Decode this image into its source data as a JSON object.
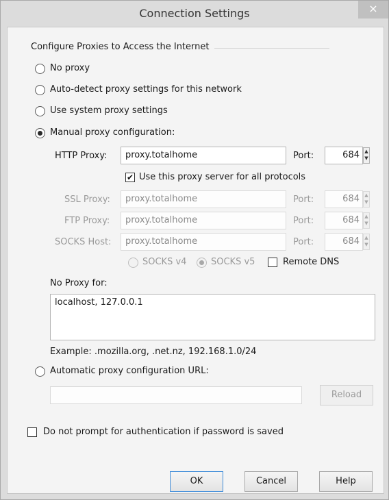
{
  "window": {
    "title": "Connection Settings",
    "close_glyph": "×"
  },
  "group": {
    "title": "Configure Proxies to Access the Internet"
  },
  "modes": {
    "no_proxy": "No proxy",
    "auto_detect": "Auto-detect proxy settings for this network",
    "system": "Use system proxy settings",
    "manual": "Manual proxy configuration:",
    "pac": "Automatic proxy configuration URL:"
  },
  "selected_mode": "manual",
  "http": {
    "label": "HTTP Proxy:",
    "value": "proxy.totalhome",
    "port_label": "Port:",
    "port": "684"
  },
  "use_for_all": {
    "label": "Use this proxy server for all protocols",
    "checked": true
  },
  "ssl": {
    "label": "SSL Proxy:",
    "value": "proxy.totalhome",
    "port_label": "Port:",
    "port": "684"
  },
  "ftp": {
    "label": "FTP Proxy:",
    "value": "proxy.totalhome",
    "port_label": "Port:",
    "port": "684"
  },
  "socks": {
    "label": "SOCKS Host:",
    "value": "proxy.totalhome",
    "port_label": "Port:",
    "port": "684"
  },
  "socks_version": {
    "v4": "SOCKS v4",
    "v5": "SOCKS v5",
    "selected": "v5"
  },
  "remote_dns": {
    "label": "Remote DNS",
    "checked": false
  },
  "no_proxy_for": {
    "label": "No Proxy for:",
    "value": "localhost, 127.0.0.1",
    "example": "Example: .mozilla.org, .net.nz, 192.168.1.0/24"
  },
  "pac": {
    "value": "",
    "reload_label": "Reload"
  },
  "auth": {
    "label": "Do not prompt for authentication if password is saved",
    "checked": false
  },
  "buttons": {
    "ok": "OK",
    "cancel": "Cancel",
    "help": "Help"
  }
}
